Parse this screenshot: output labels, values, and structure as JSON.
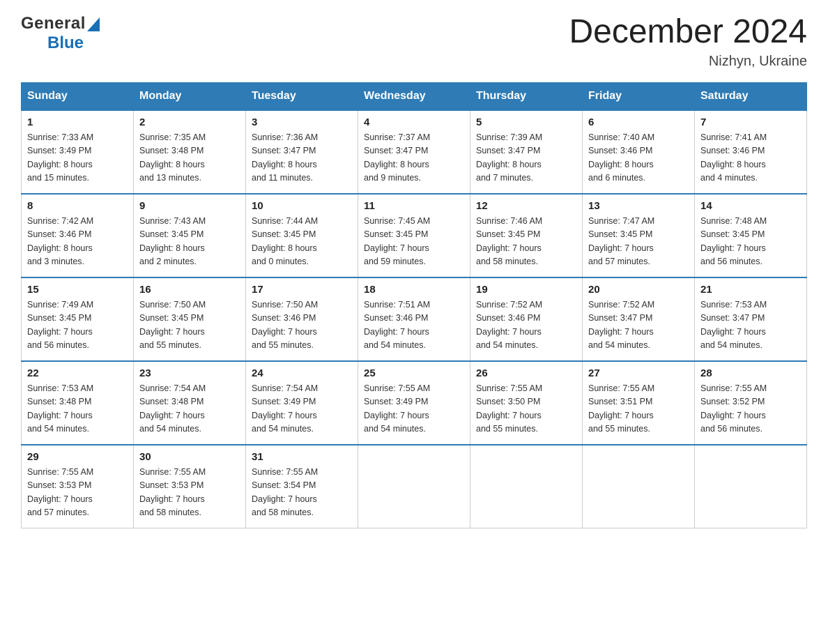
{
  "header": {
    "logo_general": "General",
    "logo_blue": "Blue",
    "month_title": "December 2024",
    "location": "Nizhyn, Ukraine"
  },
  "weekdays": [
    "Sunday",
    "Monday",
    "Tuesday",
    "Wednesday",
    "Thursday",
    "Friday",
    "Saturday"
  ],
  "weeks": [
    [
      {
        "day": "1",
        "sunrise": "Sunrise: 7:33 AM",
        "sunset": "Sunset: 3:49 PM",
        "daylight": "Daylight: 8 hours",
        "daylight2": "and 15 minutes."
      },
      {
        "day": "2",
        "sunrise": "Sunrise: 7:35 AM",
        "sunset": "Sunset: 3:48 PM",
        "daylight": "Daylight: 8 hours",
        "daylight2": "and 13 minutes."
      },
      {
        "day": "3",
        "sunrise": "Sunrise: 7:36 AM",
        "sunset": "Sunset: 3:47 PM",
        "daylight": "Daylight: 8 hours",
        "daylight2": "and 11 minutes."
      },
      {
        "day": "4",
        "sunrise": "Sunrise: 7:37 AM",
        "sunset": "Sunset: 3:47 PM",
        "daylight": "Daylight: 8 hours",
        "daylight2": "and 9 minutes."
      },
      {
        "day": "5",
        "sunrise": "Sunrise: 7:39 AM",
        "sunset": "Sunset: 3:47 PM",
        "daylight": "Daylight: 8 hours",
        "daylight2": "and 7 minutes."
      },
      {
        "day": "6",
        "sunrise": "Sunrise: 7:40 AM",
        "sunset": "Sunset: 3:46 PM",
        "daylight": "Daylight: 8 hours",
        "daylight2": "and 6 minutes."
      },
      {
        "day": "7",
        "sunrise": "Sunrise: 7:41 AM",
        "sunset": "Sunset: 3:46 PM",
        "daylight": "Daylight: 8 hours",
        "daylight2": "and 4 minutes."
      }
    ],
    [
      {
        "day": "8",
        "sunrise": "Sunrise: 7:42 AM",
        "sunset": "Sunset: 3:46 PM",
        "daylight": "Daylight: 8 hours",
        "daylight2": "and 3 minutes."
      },
      {
        "day": "9",
        "sunrise": "Sunrise: 7:43 AM",
        "sunset": "Sunset: 3:45 PM",
        "daylight": "Daylight: 8 hours",
        "daylight2": "and 2 minutes."
      },
      {
        "day": "10",
        "sunrise": "Sunrise: 7:44 AM",
        "sunset": "Sunset: 3:45 PM",
        "daylight": "Daylight: 8 hours",
        "daylight2": "and 0 minutes."
      },
      {
        "day": "11",
        "sunrise": "Sunrise: 7:45 AM",
        "sunset": "Sunset: 3:45 PM",
        "daylight": "Daylight: 7 hours",
        "daylight2": "and 59 minutes."
      },
      {
        "day": "12",
        "sunrise": "Sunrise: 7:46 AM",
        "sunset": "Sunset: 3:45 PM",
        "daylight": "Daylight: 7 hours",
        "daylight2": "and 58 minutes."
      },
      {
        "day": "13",
        "sunrise": "Sunrise: 7:47 AM",
        "sunset": "Sunset: 3:45 PM",
        "daylight": "Daylight: 7 hours",
        "daylight2": "and 57 minutes."
      },
      {
        "day": "14",
        "sunrise": "Sunrise: 7:48 AM",
        "sunset": "Sunset: 3:45 PM",
        "daylight": "Daylight: 7 hours",
        "daylight2": "and 56 minutes."
      }
    ],
    [
      {
        "day": "15",
        "sunrise": "Sunrise: 7:49 AM",
        "sunset": "Sunset: 3:45 PM",
        "daylight": "Daylight: 7 hours",
        "daylight2": "and 56 minutes."
      },
      {
        "day": "16",
        "sunrise": "Sunrise: 7:50 AM",
        "sunset": "Sunset: 3:45 PM",
        "daylight": "Daylight: 7 hours",
        "daylight2": "and 55 minutes."
      },
      {
        "day": "17",
        "sunrise": "Sunrise: 7:50 AM",
        "sunset": "Sunset: 3:46 PM",
        "daylight": "Daylight: 7 hours",
        "daylight2": "and 55 minutes."
      },
      {
        "day": "18",
        "sunrise": "Sunrise: 7:51 AM",
        "sunset": "Sunset: 3:46 PM",
        "daylight": "Daylight: 7 hours",
        "daylight2": "and 54 minutes."
      },
      {
        "day": "19",
        "sunrise": "Sunrise: 7:52 AM",
        "sunset": "Sunset: 3:46 PM",
        "daylight": "Daylight: 7 hours",
        "daylight2": "and 54 minutes."
      },
      {
        "day": "20",
        "sunrise": "Sunrise: 7:52 AM",
        "sunset": "Sunset: 3:47 PM",
        "daylight": "Daylight: 7 hours",
        "daylight2": "and 54 minutes."
      },
      {
        "day": "21",
        "sunrise": "Sunrise: 7:53 AM",
        "sunset": "Sunset: 3:47 PM",
        "daylight": "Daylight: 7 hours",
        "daylight2": "and 54 minutes."
      }
    ],
    [
      {
        "day": "22",
        "sunrise": "Sunrise: 7:53 AM",
        "sunset": "Sunset: 3:48 PM",
        "daylight": "Daylight: 7 hours",
        "daylight2": "and 54 minutes."
      },
      {
        "day": "23",
        "sunrise": "Sunrise: 7:54 AM",
        "sunset": "Sunset: 3:48 PM",
        "daylight": "Daylight: 7 hours",
        "daylight2": "and 54 minutes."
      },
      {
        "day": "24",
        "sunrise": "Sunrise: 7:54 AM",
        "sunset": "Sunset: 3:49 PM",
        "daylight": "Daylight: 7 hours",
        "daylight2": "and 54 minutes."
      },
      {
        "day": "25",
        "sunrise": "Sunrise: 7:55 AM",
        "sunset": "Sunset: 3:49 PM",
        "daylight": "Daylight: 7 hours",
        "daylight2": "and 54 minutes."
      },
      {
        "day": "26",
        "sunrise": "Sunrise: 7:55 AM",
        "sunset": "Sunset: 3:50 PM",
        "daylight": "Daylight: 7 hours",
        "daylight2": "and 55 minutes."
      },
      {
        "day": "27",
        "sunrise": "Sunrise: 7:55 AM",
        "sunset": "Sunset: 3:51 PM",
        "daylight": "Daylight: 7 hours",
        "daylight2": "and 55 minutes."
      },
      {
        "day": "28",
        "sunrise": "Sunrise: 7:55 AM",
        "sunset": "Sunset: 3:52 PM",
        "daylight": "Daylight: 7 hours",
        "daylight2": "and 56 minutes."
      }
    ],
    [
      {
        "day": "29",
        "sunrise": "Sunrise: 7:55 AM",
        "sunset": "Sunset: 3:53 PM",
        "daylight": "Daylight: 7 hours",
        "daylight2": "and 57 minutes."
      },
      {
        "day": "30",
        "sunrise": "Sunrise: 7:55 AM",
        "sunset": "Sunset: 3:53 PM",
        "daylight": "Daylight: 7 hours",
        "daylight2": "and 58 minutes."
      },
      {
        "day": "31",
        "sunrise": "Sunrise: 7:55 AM",
        "sunset": "Sunset: 3:54 PM",
        "daylight": "Daylight: 7 hours",
        "daylight2": "and 58 minutes."
      },
      null,
      null,
      null,
      null
    ]
  ]
}
